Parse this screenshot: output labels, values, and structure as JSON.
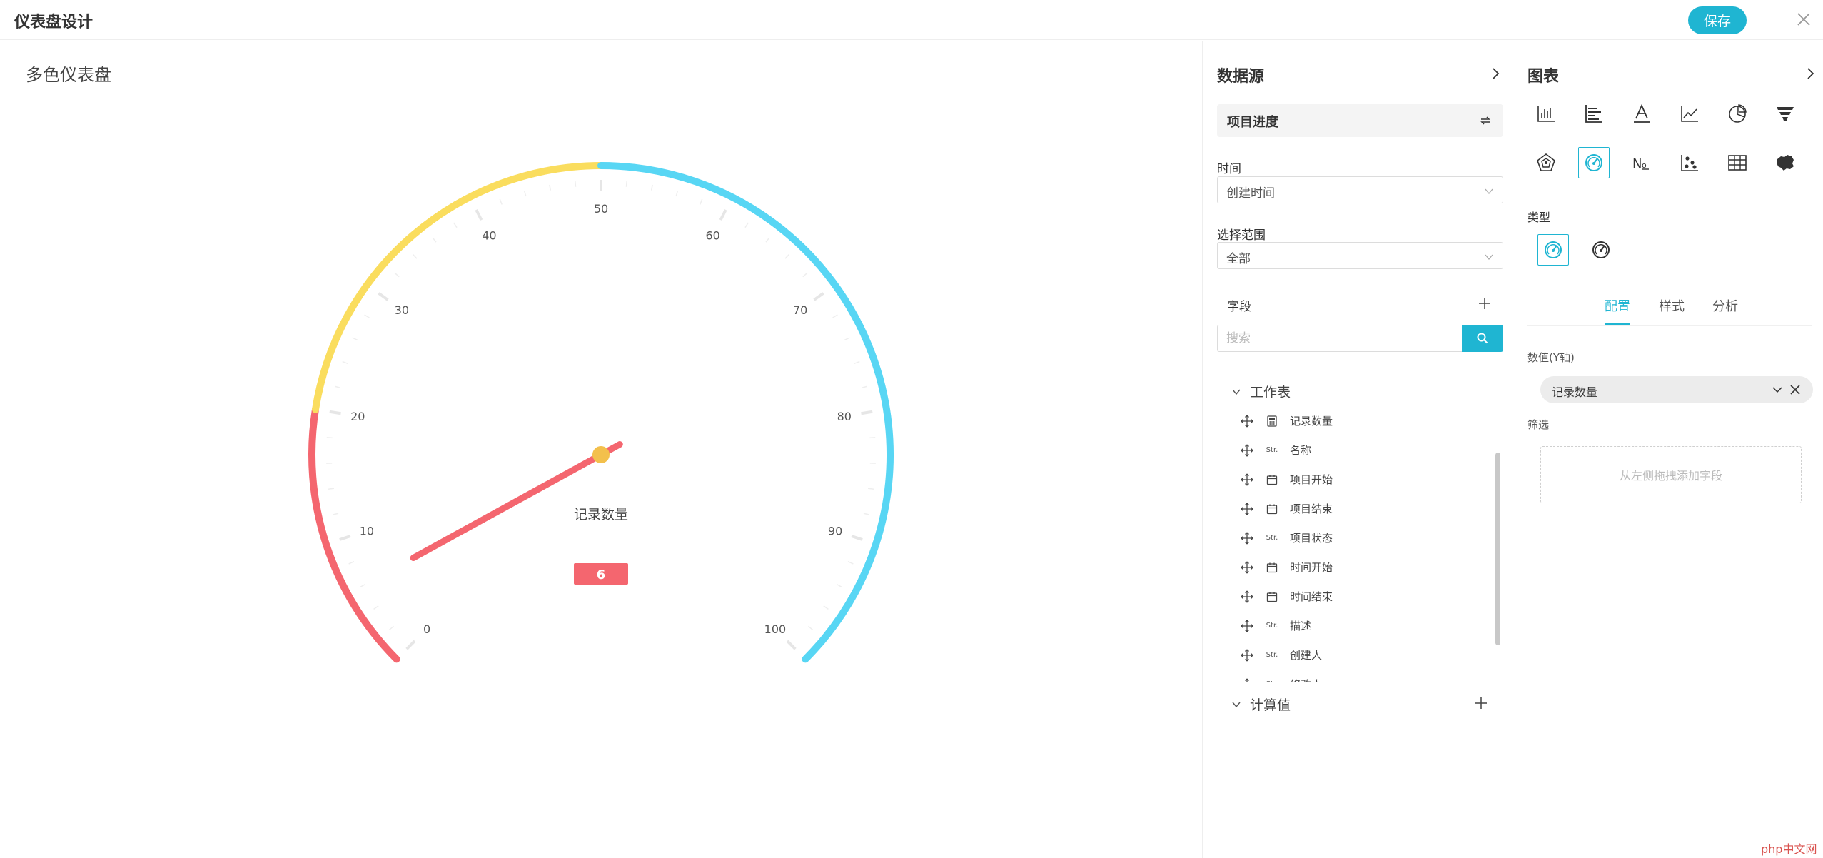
{
  "app": {
    "title": "仪表盘设计",
    "save_label": "保存"
  },
  "chart_data": {
    "type": "gauge",
    "title": "多色仪表盘",
    "min": 0,
    "max": 100,
    "value": 6,
    "value_label": "记录数量",
    "ticks": [
      "0",
      "10",
      "20",
      "30",
      "40",
      "50",
      "60",
      "70",
      "80",
      "90",
      "100"
    ],
    "color_bands": [
      {
        "from": 0,
        "to": 20,
        "color": "#f4666f"
      },
      {
        "from": 20,
        "to": 50,
        "color": "#fadd5e"
      },
      {
        "from": 50,
        "to": 100,
        "color": "#58d6f4"
      }
    ],
    "needle_color": "#f4666f",
    "needle_hub_color": "#f3c04c",
    "badge_color": "#f4666f"
  },
  "datasource": {
    "heading": "数据源",
    "source_name": "项目进度",
    "time_label": "时间",
    "time_value": "创建时间",
    "range_label": "选择范围",
    "range_value": "全部",
    "fields_title": "字段",
    "search_placeholder": "搜索",
    "worksheet_label": "工作表",
    "computed_label": "计算值",
    "fields": [
      {
        "type": "calc",
        "name": "记录数量"
      },
      {
        "type": "str",
        "name": "名称"
      },
      {
        "type": "date",
        "name": "项目开始"
      },
      {
        "type": "date",
        "name": "项目结束"
      },
      {
        "type": "str",
        "name": "项目状态"
      },
      {
        "type": "date",
        "name": "时间开始"
      },
      {
        "type": "date",
        "name": "时间结束"
      },
      {
        "type": "str",
        "name": "描述"
      },
      {
        "type": "str",
        "name": "创建人"
      },
      {
        "type": "str",
        "name": "修改人"
      }
    ],
    "str_tag": "Str."
  },
  "chart_panel": {
    "heading": "图表",
    "type_label": "类型",
    "tabs": [
      "配置",
      "样式",
      "分析"
    ],
    "active_tab": "配置",
    "value_axis_label": "数值(Y轴)",
    "value_field": "记录数量",
    "filter_label": "筛选",
    "filter_placeholder": "从左侧拖拽添加字段",
    "icons": [
      "bar-chart-icon",
      "horizontal-bar-icon",
      "text-icon",
      "line-chart-icon",
      "pie-chart-icon",
      "funnel-icon",
      "radar-icon",
      "gauge-icon",
      "number-icon",
      "scatter-icon",
      "table-icon",
      "map-icon"
    ],
    "accent_color": "#1fb5d2"
  },
  "watermark": "php中文网"
}
